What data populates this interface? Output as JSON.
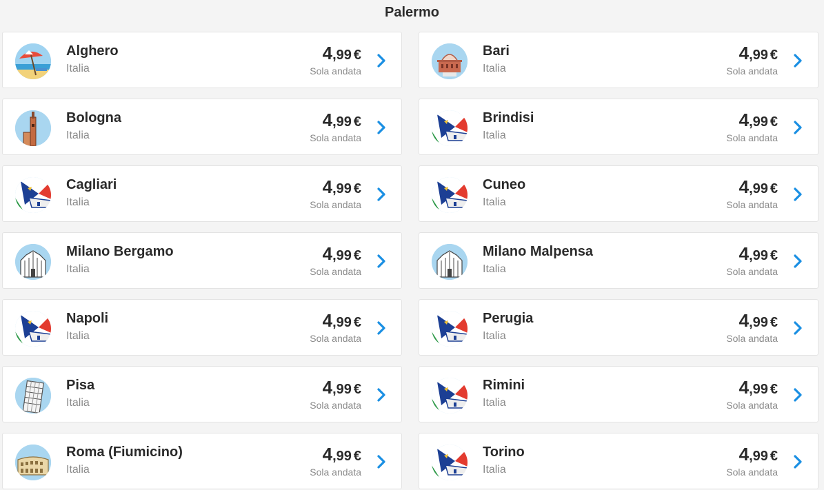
{
  "page": {
    "title": "Palermo"
  },
  "destinations": [
    {
      "city": "Alghero",
      "country": "Italia",
      "price_int": "4",
      "price_dec": ",99",
      "currency": "€",
      "fare": "Sola andata",
      "icon": "beach"
    },
    {
      "city": "Bari",
      "country": "Italia",
      "price_int": "4",
      "price_dec": ",99",
      "currency": "€",
      "fare": "Sola andata",
      "icon": "basilica"
    },
    {
      "city": "Bologna",
      "country": "Italia",
      "price_int": "4",
      "price_dec": ",99",
      "currency": "€",
      "fare": "Sola andata",
      "icon": "tower"
    },
    {
      "city": "Brindisi",
      "country": "Italia",
      "price_int": "4",
      "price_dec": ",99",
      "currency": "€",
      "fare": "Sola andata",
      "icon": "plane-tail"
    },
    {
      "city": "Cagliari",
      "country": "Italia",
      "price_int": "4",
      "price_dec": ",99",
      "currency": "€",
      "fare": "Sola andata",
      "icon": "plane-tail"
    },
    {
      "city": "Cuneo",
      "country": "Italia",
      "price_int": "4",
      "price_dec": ",99",
      "currency": "€",
      "fare": "Sola andata",
      "icon": "plane-tail"
    },
    {
      "city": "Milano Bergamo",
      "country": "Italia",
      "price_int": "4",
      "price_dec": ",99",
      "currency": "€",
      "fare": "Sola andata",
      "icon": "cathedral"
    },
    {
      "city": "Milano Malpensa",
      "country": "Italia",
      "price_int": "4",
      "price_dec": ",99",
      "currency": "€",
      "fare": "Sola andata",
      "icon": "cathedral"
    },
    {
      "city": "Napoli",
      "country": "Italia",
      "price_int": "4",
      "price_dec": ",99",
      "currency": "€",
      "fare": "Sola andata",
      "icon": "plane-tail"
    },
    {
      "city": "Perugia",
      "country": "Italia",
      "price_int": "4",
      "price_dec": ",99",
      "currency": "€",
      "fare": "Sola andata",
      "icon": "plane-tail"
    },
    {
      "city": "Pisa",
      "country": "Italia",
      "price_int": "4",
      "price_dec": ",99",
      "currency": "€",
      "fare": "Sola andata",
      "icon": "leaning-tower"
    },
    {
      "city": "Rimini",
      "country": "Italia",
      "price_int": "4",
      "price_dec": ",99",
      "currency": "€",
      "fare": "Sola andata",
      "icon": "plane-tail"
    },
    {
      "city": "Roma (Fiumicino)",
      "country": "Italia",
      "price_int": "4",
      "price_dec": ",99",
      "currency": "€",
      "fare": "Sola andata",
      "icon": "colosseum"
    },
    {
      "city": "Torino",
      "country": "Italia",
      "price_int": "4",
      "price_dec": ",99",
      "currency": "€",
      "fare": "Sola andata",
      "icon": "plane-tail"
    }
  ],
  "colors": {
    "accent": "#1a8fe3",
    "text": "#2a2a2a",
    "muted": "#8a8a8a",
    "background": "#f4f4f4"
  }
}
